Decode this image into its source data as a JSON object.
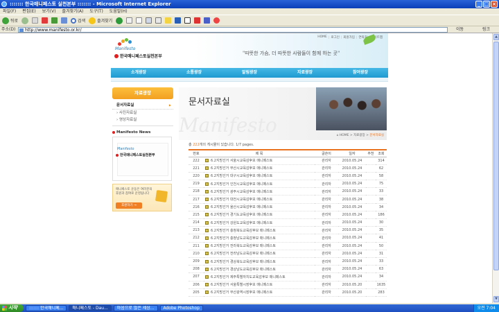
{
  "window": {
    "title": "::::::: 한국매니페스토 실천본부 ::::::: - Microsoft Internet Explorer"
  },
  "menubar": [
    "파일(F)",
    "편집(E)",
    "보기(V)",
    "즐겨찾기(A)",
    "도구(T)",
    "도움말(H)"
  ],
  "toolbar": {
    "back": "뒤로",
    "search": "검색",
    "favorites": "즐겨찾기"
  },
  "address": {
    "label": "주소(D)",
    "url": "http://www.manifesto.or.kr/",
    "go": "이동",
    "links": "링크"
  },
  "site": {
    "logo_en": "Manifesto",
    "logo_kr": "한국매니페스토실천본부",
    "topnav": [
      "HOME",
      "로그인",
      "회원가입",
      "연락처",
      "사이트맵"
    ],
    "slogan": "\"따뜻한 가슴, 더 따뜻한 사람들이 함께 하는 곳\"",
    "mainnav": [
      "소개광장",
      "소통광장",
      "알림광장",
      "자료광장",
      "참여광장"
    ]
  },
  "sidebar": {
    "title": "자료광장",
    "items": [
      "문서자료실",
      "› 사진자료실",
      "› 영상자료실"
    ],
    "news_title": "Manifesto News",
    "news_en": "Manifesto",
    "news_kr": "한국매니페스토실천본부",
    "donate_text": "매니페스토 운동은 여러분의\n후원과 참여로 운영됩니다",
    "donate_button": "후원하기 →"
  },
  "content": {
    "heading": "문서자료실",
    "watermark": "Manifesto",
    "breadcrumb": "⌂ HOME > 자료광장 >",
    "breadcrumb_current": "문서자료실",
    "count_prefix": "총 ",
    "count": "222",
    "count_suffix": "개의 게시물이 있습니다.  1/7 pages.",
    "headers": [
      "번호",
      "제 목",
      "",
      "",
      "글쓴이",
      "일자",
      "추천",
      "조회"
    ],
    "rows": [
      {
        "no": "222",
        "title": "6.2지방선거 서울시교육감후보 매니페스토",
        "author": "관리자",
        "date": "2010.05.24",
        "hits": "314"
      },
      {
        "no": "221",
        "title": "6.2지방선거 부산시교육감후보 매니페스토",
        "author": "관리자",
        "date": "2010.05.24",
        "hits": "62"
      },
      {
        "no": "220",
        "title": "6.2지방선거 대구시교육감후보 매니페스토",
        "author": "관리자",
        "date": "2010.05.24",
        "hits": "58"
      },
      {
        "no": "219",
        "title": "6.2지방선거 인천시교육감후보 매니페스토",
        "author": "관리자",
        "date": "2010.05.24",
        "hits": "75"
      },
      {
        "no": "218",
        "title": "6.2지방선거 광주시교육감후보 매니페스토",
        "author": "관리자",
        "date": "2010.05.24",
        "hits": "33"
      },
      {
        "no": "217",
        "title": "6.2지방선거 대전시교육감후보 매니페스토",
        "author": "관리자",
        "date": "2010.05.24",
        "hits": "38"
      },
      {
        "no": "216",
        "title": "6.2지방선거 울산시교육감후보 매니페스토",
        "author": "관리자",
        "date": "2010.05.24",
        "hits": "34"
      },
      {
        "no": "215",
        "title": "6.2지방선거 경기도교육감후보 매니페스토",
        "author": "관리자",
        "date": "2010.05.24",
        "hits": "186"
      },
      {
        "no": "214",
        "title": "6.2지방선거 강원도교육감후보 매니페스토",
        "author": "관리자",
        "date": "2010.05.24",
        "hits": "30"
      },
      {
        "no": "213",
        "title": "6.2지방선거 충청북도교육감후보 매니페스토",
        "author": "관리자",
        "date": "2010.05.24",
        "hits": "35"
      },
      {
        "no": "212",
        "title": "6.2지방선거 충청남도교육감후보 매니페스토",
        "author": "관리자",
        "date": "2010.05.24",
        "hits": "41"
      },
      {
        "no": "211",
        "title": "6.2지방선거 전라북도교육감후보 매니페스토",
        "author": "관리자",
        "date": "2010.05.24",
        "hits": "50"
      },
      {
        "no": "210",
        "title": "6.2지방선거 전라남도교육감후보 매니페스토",
        "author": "관리자",
        "date": "2010.05.24",
        "hits": "31"
      },
      {
        "no": "209",
        "title": "6.2지방선거 경상북도교육감후보 매니페스토",
        "author": "관리자",
        "date": "2010.05.24",
        "hits": "33"
      },
      {
        "no": "208",
        "title": "6.2지방선거 경상남도교육감후보 매니페스토",
        "author": "관리자",
        "date": "2010.05.24",
        "hits": "63"
      },
      {
        "no": "207",
        "title": "6.2지방선거 제주특별자치도교육감후보 매니페스토",
        "author": "관리자",
        "date": "2010.05.24",
        "hits": "34"
      },
      {
        "no": "206",
        "title": "6.2지방선거 서울특별시장후보 매니페스토",
        "author": "관리자",
        "date": "2010.05.20",
        "hits": "1635"
      },
      {
        "no": "205",
        "title": "6.2지방선거 부산광역시장후보 매니페스토",
        "author": "관리자",
        "date": "2010.05.20",
        "hits": "283"
      }
    ]
  },
  "taskbar": {
    "start": "시작",
    "tasks": [
      "::::::: 한국매니페...",
      "매니페스토 - Dau...",
      "마음으로 많은 세상...",
      "Adobe Photoshop"
    ],
    "time": "오전 7:04"
  },
  "status": {
    "zone": "인터넷"
  }
}
